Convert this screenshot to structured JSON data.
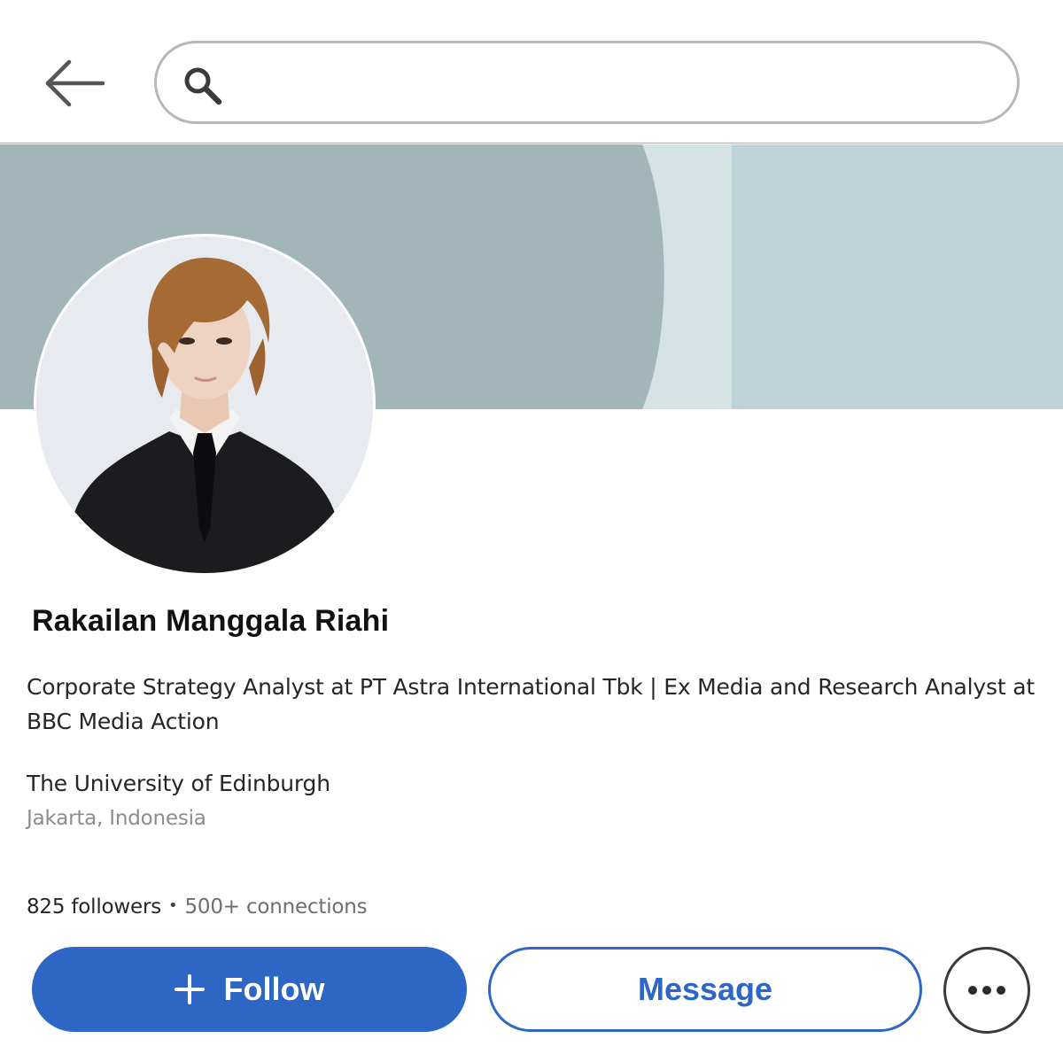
{
  "header": {
    "back_icon": "arrow-left-icon",
    "search": {
      "icon": "search-icon",
      "value": "",
      "placeholder": ""
    }
  },
  "profile": {
    "name": "Rakailan Manggala Riahi",
    "headline": "Corporate Strategy Analyst at PT Astra International Tbk | Ex Media and Research Analyst at BBC Media Action",
    "education": "The University of Edinburgh",
    "location": "Jakarta, Indonesia",
    "followers": "825 followers",
    "separator": "•",
    "connections": "500+ connections"
  },
  "actions": {
    "follow_icon": "plus-icon",
    "follow_label": "Follow",
    "message_label": "Message",
    "more_icon": "more-horizontal-icon"
  },
  "colors": {
    "accent": "#2d66c5",
    "banner_dark": "#a2b5b8",
    "banner_light": "#bed3d7",
    "banner_stripe": "#d6e3e5",
    "secondary_text": "#8c8c8c"
  }
}
